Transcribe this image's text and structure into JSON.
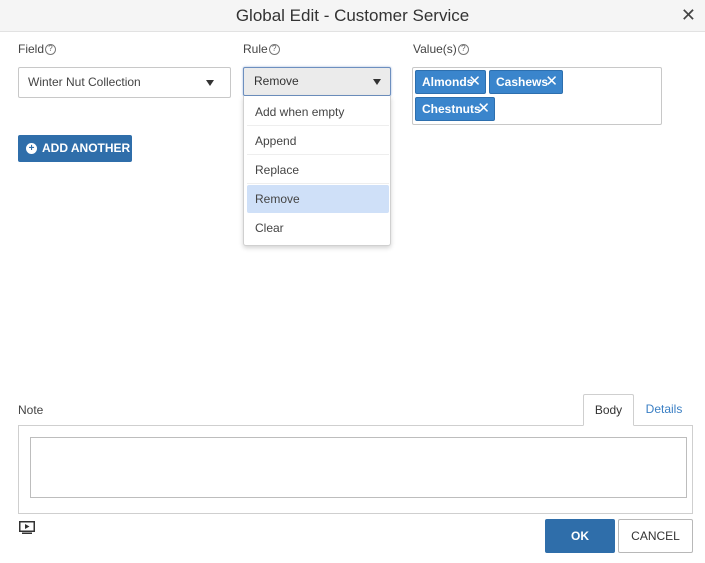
{
  "dialog": {
    "title": "Global Edit - Customer Service",
    "close_glyph": "✕"
  },
  "columns": {
    "field_label": "Field",
    "rule_label": "Rule",
    "values_label": "Value(s)",
    "help_glyph": "?"
  },
  "field_select": {
    "value": "Winter Nut Collection"
  },
  "rule_select": {
    "value": "Remove",
    "options": [
      "Add when empty",
      "Append",
      "Replace",
      "Remove",
      "Clear"
    ],
    "selected_option": "Remove"
  },
  "values": {
    "tags": [
      "Almonds",
      "Cashews",
      "Chestnuts"
    ],
    "remove_glyph": "✕"
  },
  "add_another": {
    "icon_glyph": "+",
    "label": "ADD ANOTHER"
  },
  "note": {
    "label": "Note",
    "tabs": [
      "Body",
      "Details"
    ],
    "active_tab": "Body",
    "body_text": ""
  },
  "footer": {
    "ok_label": "OK",
    "cancel_label": "CANCEL"
  },
  "icons": {
    "preview": "preview-icon",
    "help": "help-icon",
    "close": "close-icon",
    "caret": "caret-down-icon",
    "plus": "plus-circle-icon"
  },
  "colors": {
    "primary": "#2f6eaa",
    "tag": "#3a85cc",
    "selected_option": "#cfe0f8",
    "link": "#3a7fc4"
  }
}
